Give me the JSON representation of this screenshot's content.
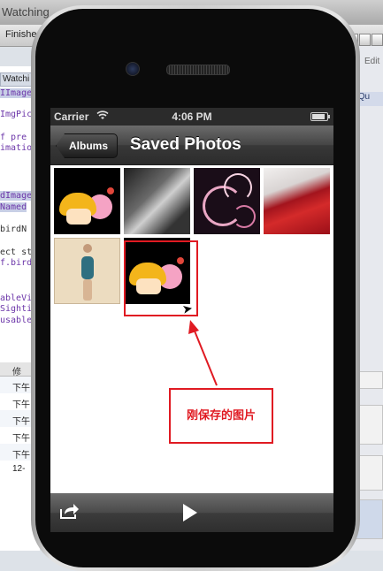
{
  "background": {
    "window_title": "Watching",
    "toolbar_label": "Finishe",
    "edit_label": "Edit",
    "tab_label": "Watchi",
    "code_lines": [
      "IImage",
      "ImgPic",
      "f pre",
      "imatio",
      "dImage",
      "Named",
      "birdN",
      "ect st",
      "f.bird",
      "ableVi",
      "Sighti",
      "usable"
    ],
    "list_header": "修改",
    "list_rows": [
      "下午",
      "下午",
      "下午",
      "下午",
      "下午",
      "12-"
    ],
    "right_section": "Qu"
  },
  "status_bar": {
    "carrier": "Carrier",
    "time": "4:06 PM",
    "battery_level": 0.85
  },
  "navigation": {
    "back_label": "Albums",
    "title": "Saved Photos"
  },
  "photos": [
    {
      "label": "mushroom-cartoon"
    },
    {
      "label": "bw-portrait"
    },
    {
      "label": "pink-swirls"
    },
    {
      "label": "red-dress"
    },
    {
      "label": "swimsuit-figure"
    },
    {
      "label": "mushroom-cartoon-saved"
    }
  ],
  "annotation": {
    "text": "刚保存的图片",
    "color": "#e01a22"
  },
  "toolbar": {
    "share_icon": "share-icon",
    "play_icon": "play-icon"
  }
}
